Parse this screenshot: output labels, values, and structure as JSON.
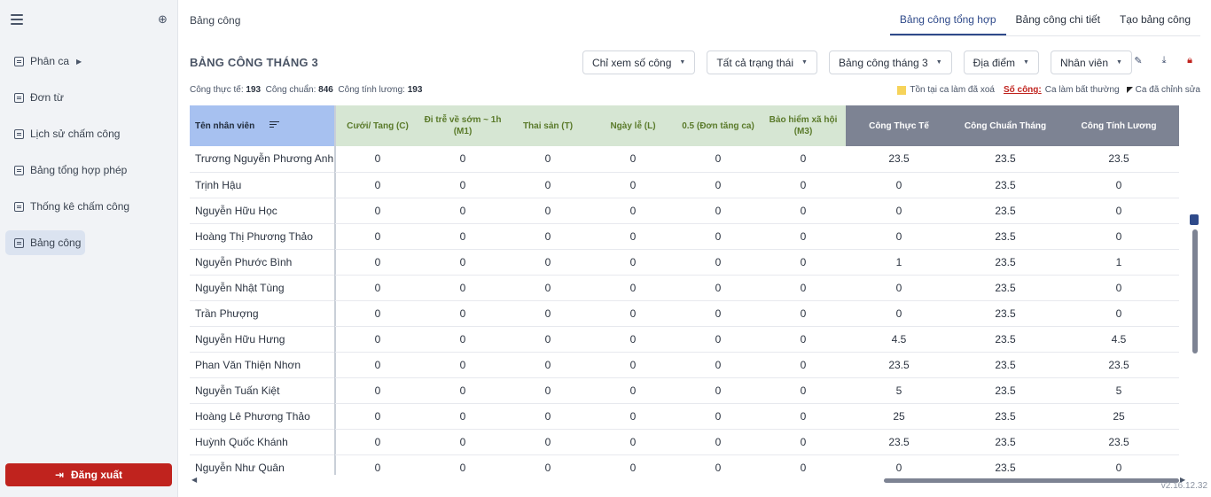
{
  "sidebar": {
    "items": [
      {
        "label": "Phân ca",
        "has_caret": true
      },
      {
        "label": "Đơn từ"
      },
      {
        "label": "Lịch sử chấm công"
      },
      {
        "label": "Bảng tổng hợp phép"
      },
      {
        "label": "Thống kê chấm công"
      },
      {
        "label": "Bảng công",
        "active": true
      }
    ],
    "logout_label": "Đăng xuất"
  },
  "header": {
    "breadcrumb": "Bảng công",
    "tabs": [
      {
        "label": "Bảng công tổng hợp",
        "active": true
      },
      {
        "label": "Bảng công chi tiết"
      },
      {
        "label": "Tạo bảng công"
      }
    ]
  },
  "page": {
    "title": "BẢNG CÔNG THÁNG 3",
    "filters": [
      "Chỉ xem số công",
      "Tất cả trạng thái",
      "Bảng công tháng 3",
      "Địa điểm",
      "Nhân viên"
    ],
    "summary": {
      "actual_label": "Công thực tế:",
      "actual_value": "193",
      "standard_label": "Công chuẩn:",
      "standard_value": "846",
      "payroll_label": "Công tính lương:",
      "payroll_value": "193"
    },
    "legend": {
      "deleted_shift": "Tồn tại ca làm đã xoá",
      "so_cong": "Số công:",
      "abnormal": "Ca làm bất thường",
      "edited": "Ca đã chỉnh sửa"
    },
    "version": "v2.16.12.32"
  },
  "table": {
    "name_header": "Tên nhân viên",
    "partial_header": ")",
    "columns": [
      "Cưới/ Tang (C)",
      "Đi trễ về sớm ~ 1h (M1)",
      "Thai sản (T)",
      "Ngày lễ (L)",
      "0.5 (Đơn tăng ca)",
      "Bảo hiểm xã hội (M3)",
      "Công Thực Tế",
      "Công Chuẩn Tháng",
      "Công Tính Lương"
    ],
    "rows": [
      {
        "name": "Trương Nguyễn Phương Anh",
        "values": [
          "0",
          "0",
          "0",
          "0",
          "0",
          "0",
          "23.5",
          "23.5",
          "23.5"
        ]
      },
      {
        "name": "Trịnh Hậu",
        "values": [
          "0",
          "0",
          "0",
          "0",
          "0",
          "0",
          "0",
          "23.5",
          "0"
        ]
      },
      {
        "name": "Nguyễn Hữu Học",
        "values": [
          "0",
          "0",
          "0",
          "0",
          "0",
          "0",
          "0",
          "23.5",
          "0"
        ]
      },
      {
        "name": "Hoàng Thị Phương Thảo",
        "values": [
          "0",
          "0",
          "0",
          "0",
          "0",
          "0",
          "0",
          "23.5",
          "0"
        ]
      },
      {
        "name": "Nguyễn Phước Bình",
        "values": [
          "0",
          "0",
          "0",
          "0",
          "0",
          "0",
          "1",
          "23.5",
          "1"
        ]
      },
      {
        "name": "Nguyễn Nhật Tùng",
        "values": [
          "0",
          "0",
          "0",
          "0",
          "0",
          "0",
          "0",
          "23.5",
          "0"
        ]
      },
      {
        "name": "Trần Phượng",
        "values": [
          "0",
          "0",
          "0",
          "0",
          "0",
          "0",
          "0",
          "23.5",
          "0"
        ]
      },
      {
        "name": "Nguyễn Hữu Hưng",
        "values": [
          "0",
          "0",
          "0",
          "0",
          "0",
          "0",
          "4.5",
          "23.5",
          "4.5"
        ]
      },
      {
        "name": "Phan Văn Thiện Nhơn",
        "values": [
          "0",
          "0",
          "0",
          "0",
          "0",
          "0",
          "23.5",
          "23.5",
          "23.5"
        ]
      },
      {
        "name": "Nguyễn Tuấn Kiệt",
        "values": [
          "0",
          "0",
          "0",
          "0",
          "0",
          "0",
          "5",
          "23.5",
          "5"
        ]
      },
      {
        "name": "Hoàng Lê Phương Thảo",
        "values": [
          "0",
          "0",
          "0",
          "0",
          "0",
          "0",
          "25",
          "23.5",
          "25"
        ]
      },
      {
        "name": "Huỳnh Quốc Khánh",
        "values": [
          "0",
          "0",
          "0",
          "0",
          "0",
          "0",
          "23.5",
          "23.5",
          "23.5"
        ]
      },
      {
        "name": "Nguyễn Như Quân",
        "values": [
          "0",
          "0",
          "0",
          "0",
          "0",
          "0",
          "0",
          "23.5",
          "0"
        ]
      }
    ]
  }
}
